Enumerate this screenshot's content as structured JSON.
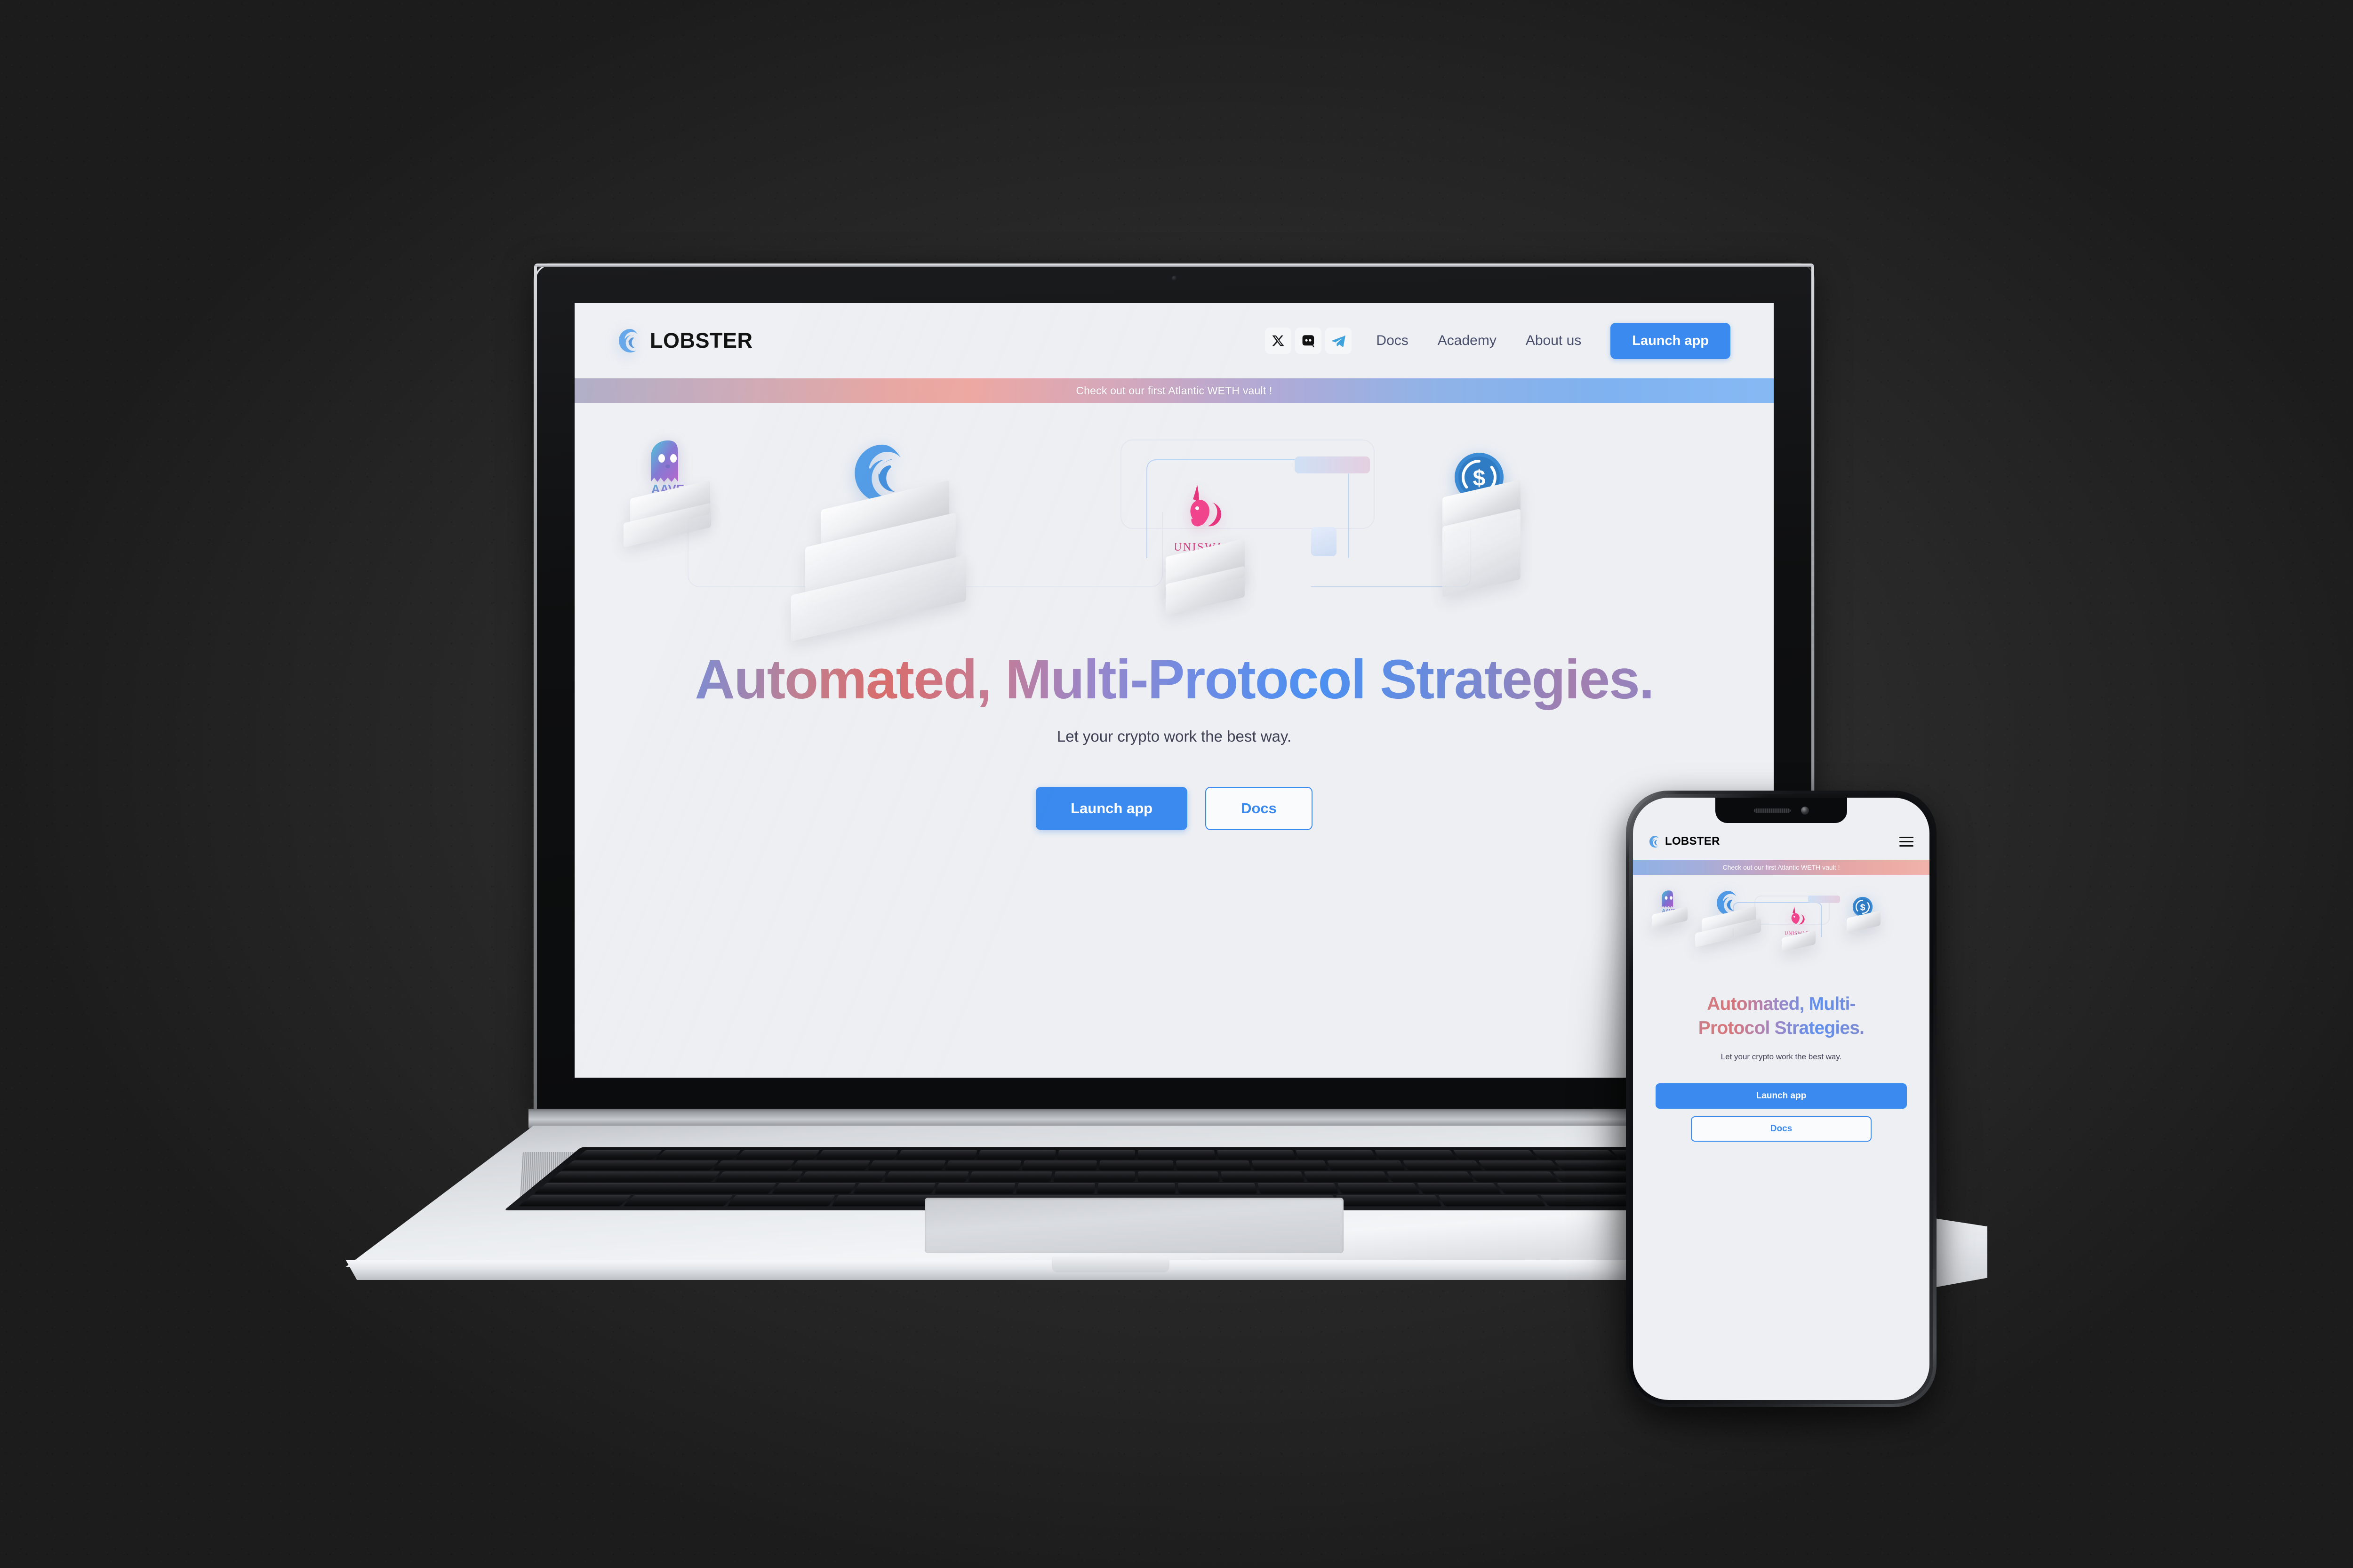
{
  "scene": {
    "background_color": "#2c2c2c",
    "devices": [
      "laptop",
      "phone"
    ]
  },
  "site": {
    "brand": {
      "name": "LOBSTER",
      "mark": "lobster-claw-icon"
    },
    "nav": {
      "socials": [
        {
          "name": "x-twitter-icon",
          "label": "X"
        },
        {
          "name": "discord-icon",
          "label": "Discord"
        },
        {
          "name": "telegram-icon",
          "label": "Telegram"
        }
      ],
      "links": [
        {
          "label": "Docs"
        },
        {
          "label": "Academy"
        },
        {
          "label": "About us"
        }
      ],
      "cta_label": "Launch app"
    },
    "banner": {
      "text": "Check out our first Atlantic WETH vault !",
      "gradient_from": "#a9a7c4",
      "gradient_mid": "#e8a49f",
      "gradient_to": "#7fb2f0"
    },
    "hero": {
      "headline": "Automated, Multi-Protocol Strategies.",
      "headline_mobile_line1": "Automated, Multi-",
      "headline_mobile_line2": "Protocol Strategies.",
      "subhead": "Let your crypto work the best way.",
      "primary_cta": "Launch app",
      "secondary_cta": "Docs",
      "accent_color": "#3b8aef",
      "protocols": [
        {
          "name": "aave-logo",
          "label": "AAVE"
        },
        {
          "name": "lobster-logo",
          "label": ""
        },
        {
          "name": "uniswap-logo",
          "label": "UNISWAP"
        },
        {
          "name": "usdc-logo",
          "label": ""
        }
      ]
    },
    "phone": {
      "menu_icon": "hamburger-menu-icon"
    }
  }
}
